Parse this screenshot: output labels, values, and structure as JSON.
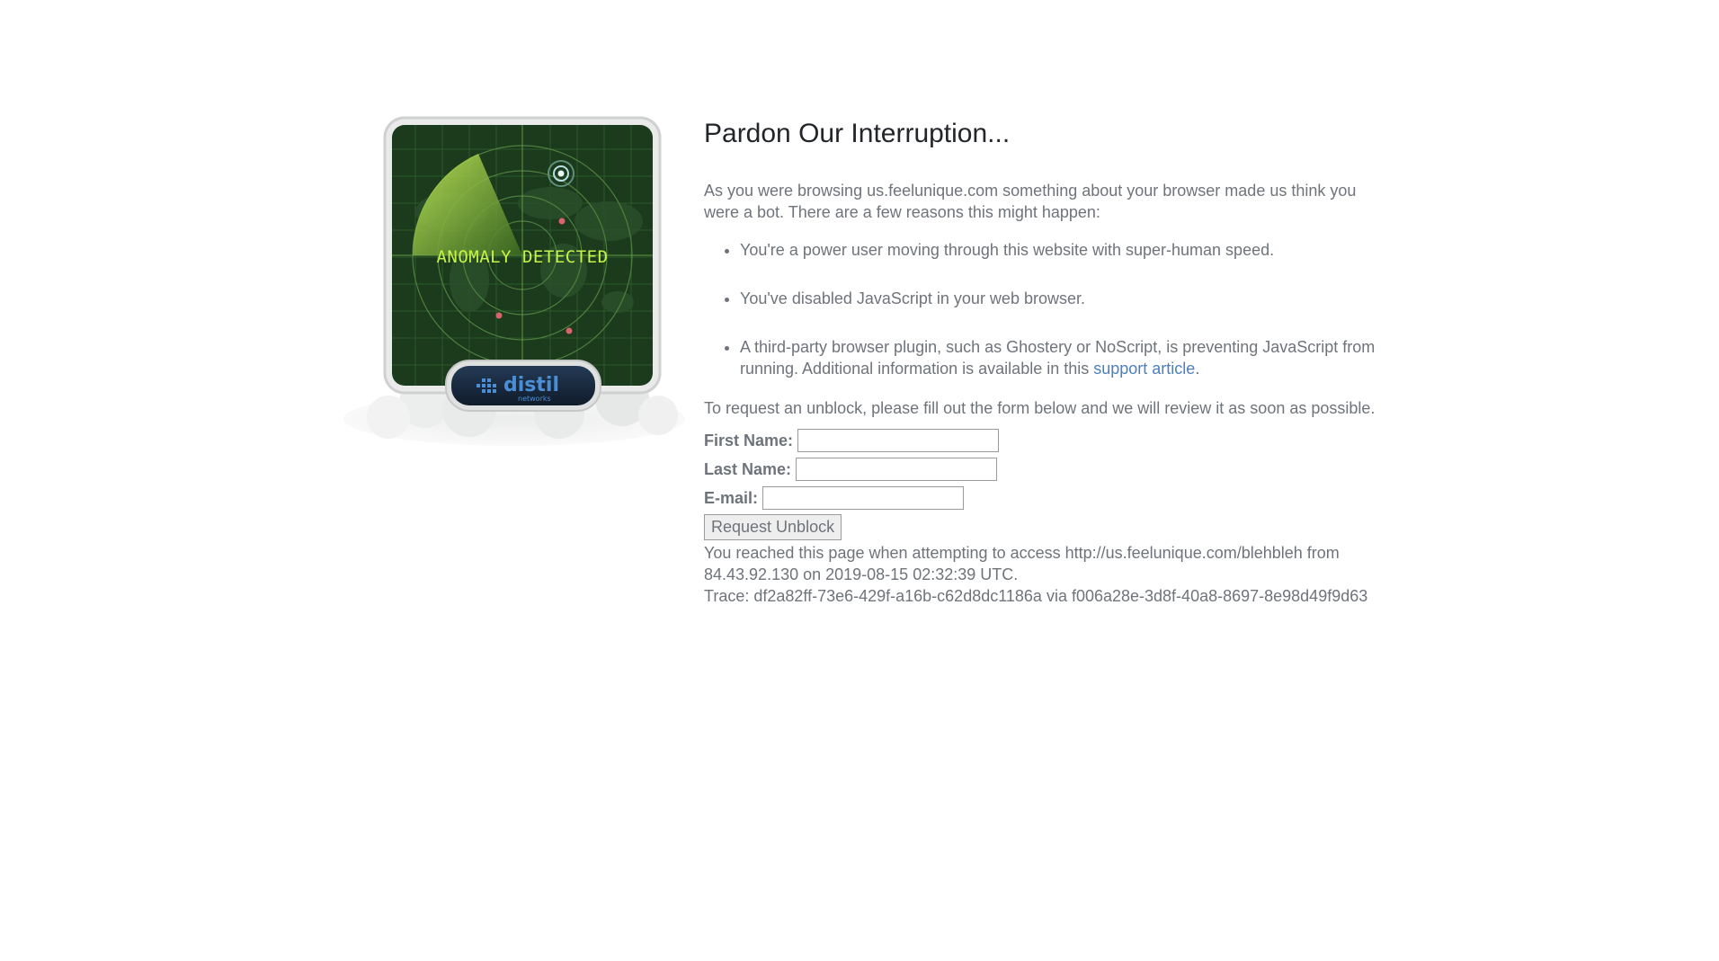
{
  "illustration": {
    "radar_text": "ANOMALY DETECTED",
    "brand_name": "distil",
    "brand_sub": "networks"
  },
  "heading": "Pardon Our Interruption...",
  "intro": "As you were browsing us.feelunique.com something about your browser made us think you were a bot. There are a few reasons this might happen:",
  "reasons": [
    "You're a power user moving through this website with super-human speed.",
    "You've disabled JavaScript in your web browser."
  ],
  "reason3": {
    "text": "A third-party browser plugin, such as Ghostery or NoScript, is preventing JavaScript from running. Additional information is available in this",
    "link_text": "support article",
    "suffix": "."
  },
  "request_text": "To request an unblock, please fill out the form below and we will review it as soon as possible.",
  "form": {
    "first_name_label": "First Name:",
    "first_name_value": "",
    "last_name_label": "Last Name:",
    "last_name_value": "",
    "email_label": "E-mail:",
    "email_value": "",
    "submit_label": "Request Unblock"
  },
  "access_info": "You reached this page when attempting to access http://us.feelunique.com/blehbleh from 84.43.92.130 on 2019-08-15 02:32:39 UTC.",
  "trace_info": "Trace: df2a82ff-73e6-429f-a16b-c62d8dc1186a via f006a28e-3d8f-40a8-8697-8e98d49f9d63",
  "colors": {
    "link": "#4a7fc1",
    "text": "#6f747a",
    "heading": "#222529",
    "radar_bg": "#1c3a1c",
    "radar_text": "#c6f24a"
  }
}
